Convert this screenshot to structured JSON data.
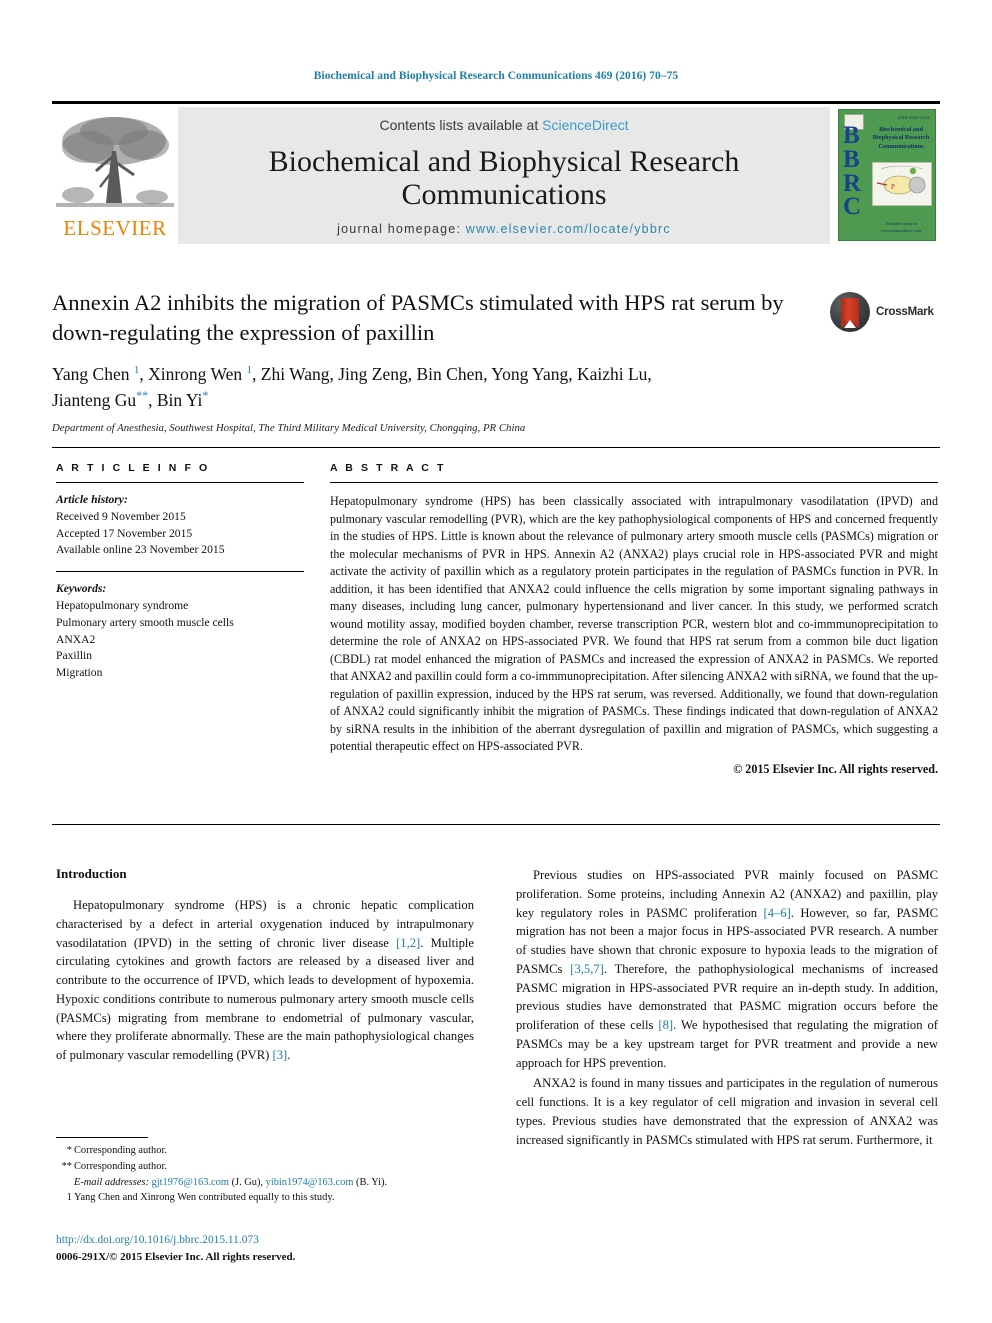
{
  "running_head": "Biochemical and Biophysical Research Communications 469 (2016) 70–75",
  "masthead": {
    "contents_prefix": "Contents lists available at ",
    "sciencedirect": "ScienceDirect",
    "journal_title": "Biochemical and Biophysical Research Communications",
    "homepage_label": "journal homepage: ",
    "homepage_url": "www.elsevier.com/locate/ybbrc",
    "publisher_logo_text": "ELSEVIER",
    "cover": {
      "initials": "BBRC",
      "title_lines": "Biochemical and Biophysical Research Communications",
      "top_right": "ISSN 0006-291X",
      "bottom_text": "Available online at www.sciencedirect.com"
    },
    "colors": {
      "band_background": "#e8e8e8",
      "link": "#2e86ab",
      "elsevier_orange": "#ef8200",
      "cover_green": "#4e9a51"
    }
  },
  "article": {
    "title": "Annexin A2 inhibits the migration of PASMCs stimulated with HPS rat serum by down-regulating the expression of paxillin",
    "crossmark_label": "CrossMark",
    "authors_line1": "Yang Chen ",
    "authors_line1_sup1": "1",
    "authors_line1_b": ", Xinrong Wen ",
    "authors_line1_sup2": "1",
    "authors_line1_c": ", Zhi Wang, Jing Zeng, Bin Chen, Yong Yang, Kaizhi Lu,",
    "authors_line2_a": "Jianteng Gu",
    "authors_line2_sup": "**",
    "authors_line2_b": ", Bin Yi",
    "authors_line2_sup2": "*",
    "affiliation": "Department of Anesthesia, Southwest Hospital, The Third Military Medical University, Chongqing, PR China"
  },
  "info": {
    "heading": "A R T I C L E   I N F O",
    "history_label": "Article history:",
    "history": [
      "Received 9 November 2015",
      "Accepted 17 November 2015",
      "Available online 23 November 2015"
    ],
    "keywords_label": "Keywords:",
    "keywords": [
      "Hepatopulmonary syndrome",
      "Pulmonary artery smooth muscle cells",
      "ANXA2",
      "Paxillin",
      "Migration"
    ]
  },
  "abstract": {
    "heading": "A B S T R A C T",
    "text": "Hepatopulmonary syndrome (HPS) has been classically associated with intrapulmonary vasodilatation (IPVD) and pulmonary vascular remodelling (PVR), which are the key pathophysiological components of HPS and concerned frequently in the studies of HPS. Little is known about the relevance of pulmonary artery smooth muscle cells (PASMCs) migration or the molecular mechanisms of PVR in HPS. Annexin A2 (ANXA2) plays crucial role in HPS-associated PVR and might activate the activity of paxillin which as a regulatory protein participates in the regulation of PASMCs function in PVR. In addition, it has been identified that ANXA2 could influence the cells migration by some important signaling pathways in many diseases, including lung cancer, pulmonary hypertensionand and liver cancer. In this study, we performed scratch wound motility assay, modified boyden chamber, reverse transcription PCR, western blot and co-immmunoprecipitation to determine the role of ANXA2 on HPS-associated PVR. We found that HPS rat serum from a common bile duct ligation (CBDL) rat model enhanced the migration of PASMCs and increased the expression of ANXA2 in PASMCs. We reported that ANXA2 and paxillin could form a co-immmunoprecipitation. After silencing ANXA2 with siRNA, we found that the up-regulation of paxillin expression, induced by the HPS rat serum, was reversed. Additionally, we found that down-regulation of ANXA2 could significantly inhibit the migration of PASMCs. These findings indicated that down-regulation of ANXA2 by siRNA results in the inhibition of the aberrant dysregulation of paxillin and migration of PASMCs, which suggesting a potential therapeutic effect on HPS-associated PVR.",
    "copyright": "© 2015 Elsevier Inc. All rights reserved."
  },
  "body": {
    "intro_heading": "Introduction",
    "left_paragraphs": [
      {
        "parts": [
          {
            "t": "Hepatopulmonary syndrome (HPS) is a chronic hepatic complication characterised by a defect in arterial oxygenation induced by intrapulmonary vasodilatation (IPVD) in the setting of chronic liver disease ",
            "ref": false
          },
          {
            "t": "[1,2]",
            "ref": true
          },
          {
            "t": ". Multiple circulating cytokines and growth factors are released by a diseased liver and contribute to the occurrence of IPVD, which leads to development of hypoxemia. Hypoxic conditions contribute to numerous pulmonary artery smooth muscle cells (PASMCs) migrating from membrane to endometrial of pulmonary vascular, where they proliferate abnormally. These are the main pathophysiological changes of pulmonary vascular remodelling (PVR) ",
            "ref": false
          },
          {
            "t": "[3]",
            "ref": true
          },
          {
            "t": ".",
            "ref": false
          }
        ]
      }
    ],
    "right_paragraphs": [
      {
        "parts": [
          {
            "t": "Previous studies on HPS-associated PVR mainly focused on PASMC proliferation. Some proteins, including Annexin A2 (ANXA2) and paxillin, play key regulatory roles in PASMC proliferation ",
            "ref": false
          },
          {
            "t": "[4–6]",
            "ref": true
          },
          {
            "t": ". However, so far, PASMC migration has not been a major focus in HPS-associated PVR research. A number of studies have shown that chronic exposure to hypoxia leads to the migration of PASMCs ",
            "ref": false
          },
          {
            "t": "[3,5,7]",
            "ref": true
          },
          {
            "t": ". Therefore, the pathophysiological mechanisms of increased PASMC migration in HPS-associated PVR require an in-depth study. In addition, previous studies have demonstrated that PASMC migration occurs before the proliferation of these cells ",
            "ref": false
          },
          {
            "t": "[8]",
            "ref": true
          },
          {
            "t": ". We hypothesised that regulating the migration of PASMCs may be a key upstream target for PVR treatment and provide a new approach for HPS prevention.",
            "ref": false
          }
        ]
      },
      {
        "parts": [
          {
            "t": "ANXA2 is found in many tissues and participates in the regulation of numerous cell functions. It is a key regulator of cell migration and invasion in several cell types. Previous studies have demonstrated that the expression of ANXA2 was increased significantly in PASMCs stimulated with HPS rat serum. Furthermore, it",
            "ref": false
          }
        ]
      }
    ]
  },
  "footnotes": {
    "corresponding1_mark": "*",
    "corresponding1": "Corresponding author.",
    "corresponding2_mark": "**",
    "corresponding2": "Corresponding author.",
    "email_label": "E-mail addresses:",
    "email1": "gjt1976@163.com",
    "email1_owner": "(J. Gu),",
    "email2": "yibin1974@163.com",
    "email2_owner": "(B. Yi).",
    "equal_mark": "1",
    "equal_contrib": "Yang Chen and Xinrong Wen contributed equally to this study."
  },
  "doi": {
    "url": "http://dx.doi.org/10.1016/j.bbrc.2015.11.073",
    "issn_line": "0006-291X/© 2015 Elsevier Inc. All rights reserved."
  }
}
